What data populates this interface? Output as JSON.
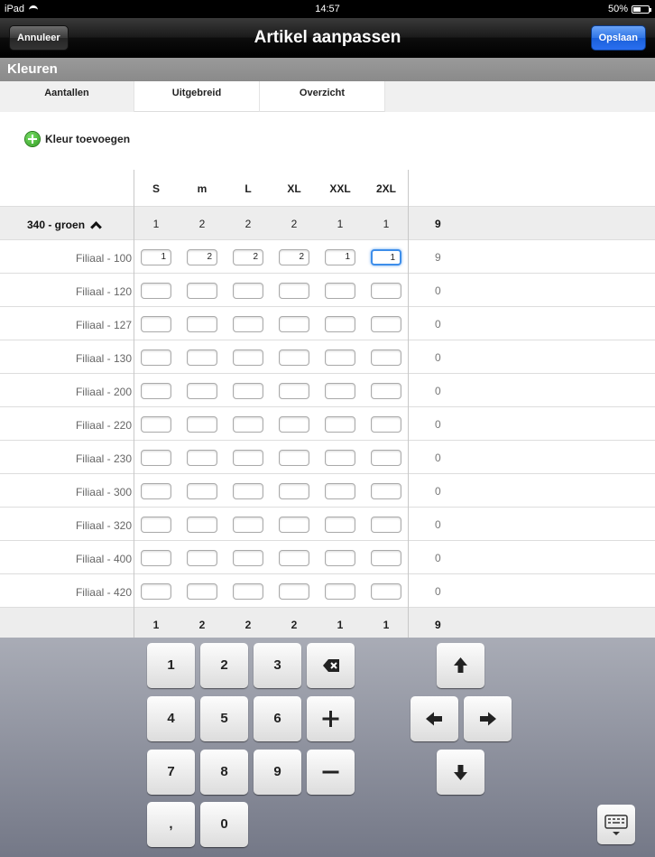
{
  "status": {
    "device": "iPad",
    "time": "14:57",
    "battery": "50%",
    "battery_level": 0.5
  },
  "navbar": {
    "title": "Artikel aanpassen",
    "cancel_label": "Annuleer",
    "save_label": "Opslaan"
  },
  "section": {
    "title": "Kleuren"
  },
  "tabs": [
    {
      "label": "Aantallen",
      "active": true
    },
    {
      "label": "Uitgebreid"
    },
    {
      "label": "Overzicht"
    }
  ],
  "add_color": {
    "label": "Kleur toevoegen",
    "icon": "plus-circle-icon"
  },
  "grid": {
    "sizes": [
      "S",
      "m",
      "L",
      "XL",
      "XXL",
      "2XL"
    ],
    "group": {
      "label": "340 - groen",
      "values": [
        "1",
        "2",
        "2",
        "2",
        "1",
        "1"
      ],
      "total": "9"
    },
    "rows": [
      {
        "label": "Filiaal - 100",
        "values": [
          "1",
          "2",
          "2",
          "2",
          "1",
          "1"
        ],
        "total": "9"
      },
      {
        "label": "Filiaal - 120",
        "values": [
          "",
          "",
          "",
          "",
          "",
          ""
        ],
        "total": "0"
      },
      {
        "label": "Filiaal - 127",
        "values": [
          "",
          "",
          "",
          "",
          "",
          ""
        ],
        "total": "0"
      },
      {
        "label": "Filiaal - 130",
        "values": [
          "",
          "",
          "",
          "",
          "",
          ""
        ],
        "total": "0"
      },
      {
        "label": "Filiaal - 200",
        "values": [
          "",
          "",
          "",
          "",
          "",
          ""
        ],
        "total": "0"
      },
      {
        "label": "Filiaal - 220",
        "values": [
          "",
          "",
          "",
          "",
          "",
          ""
        ],
        "total": "0"
      },
      {
        "label": "Filiaal - 230",
        "values": [
          "",
          "",
          "",
          "",
          "",
          ""
        ],
        "total": "0"
      },
      {
        "label": "Filiaal - 300",
        "values": [
          "",
          "",
          "",
          "",
          "",
          ""
        ],
        "total": "0"
      },
      {
        "label": "Filiaal - 320",
        "values": [
          "",
          "",
          "",
          "",
          "",
          ""
        ],
        "total": "0"
      },
      {
        "label": "Filiaal - 400",
        "values": [
          "",
          "",
          "",
          "",
          "",
          ""
        ],
        "total": "0"
      },
      {
        "label": "Filiaal - 420",
        "values": [
          "",
          "",
          "",
          "",
          "",
          ""
        ],
        "total": "0"
      }
    ],
    "totals": {
      "values": [
        "1",
        "2",
        "2",
        "2",
        "1",
        "1"
      ],
      "total": "9"
    }
  },
  "keypad": {
    "keys": [
      {
        "label": "1"
      },
      {
        "label": "2"
      },
      {
        "label": "3"
      },
      {
        "icon": "backspace-icon"
      },
      {
        "label": "4"
      },
      {
        "label": "5"
      },
      {
        "label": "6"
      },
      {
        "icon": "plus-icon"
      },
      {
        "label": "7"
      },
      {
        "label": "8"
      },
      {
        "label": "9"
      },
      {
        "icon": "minus-icon"
      },
      {
        "label": ","
      },
      {
        "label": "0"
      }
    ],
    "arrows": [
      "arrow-up-icon",
      "arrow-left-icon",
      "arrow-right-icon",
      "arrow-down-icon"
    ],
    "hide_keyboard_icon": "keyboard-hide-icon"
  }
}
